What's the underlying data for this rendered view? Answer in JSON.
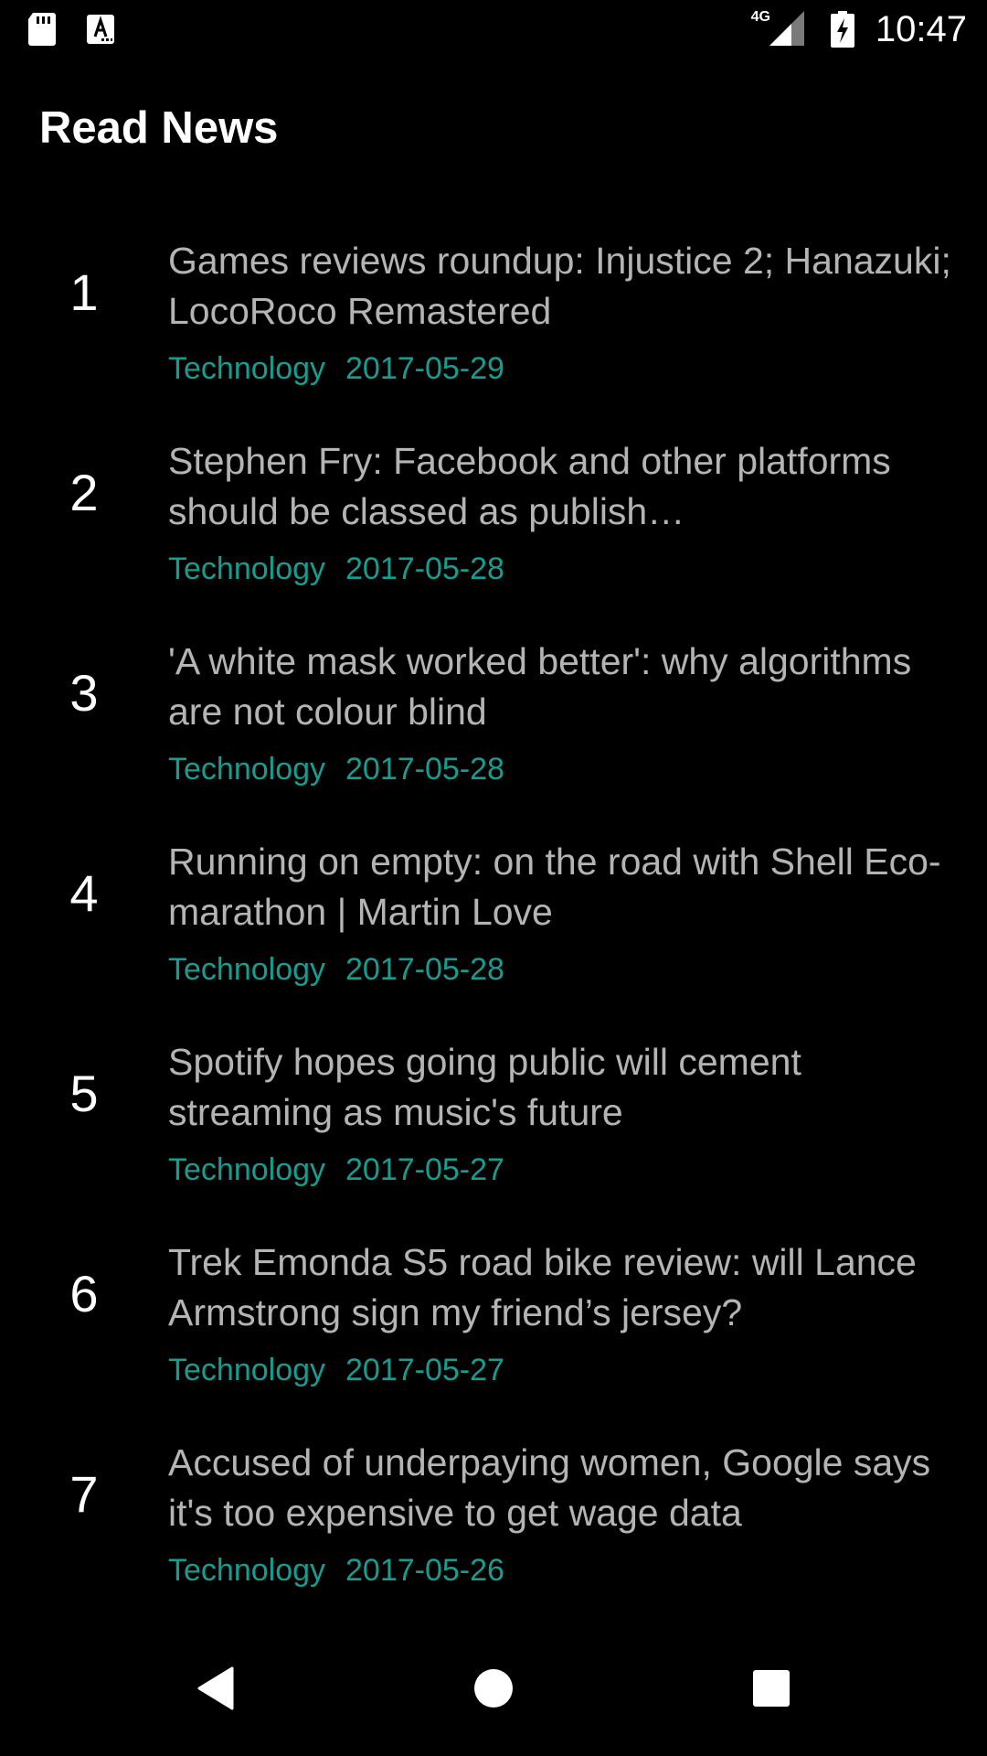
{
  "status_bar": {
    "time": "10:47",
    "network": "4G",
    "left_icons": [
      "sd-card-icon",
      "font-download-icon"
    ],
    "right_icons": [
      "signal-icon",
      "battery-charging-icon"
    ]
  },
  "app_bar": {
    "title": "Read News"
  },
  "news": [
    {
      "index": "1",
      "title": "Games reviews roundup: Injustice 2; Hanazuki; LocoRoco Remastered",
      "category": "Technology",
      "date": "2017-05-29"
    },
    {
      "index": "2",
      "title": "Stephen Fry: Facebook and other platforms should be classed as publish…",
      "category": "Technology",
      "date": "2017-05-28"
    },
    {
      "index": "3",
      "title": "'A white mask worked better': why algorithms are not colour blind",
      "category": "Technology",
      "date": "2017-05-28"
    },
    {
      "index": "4",
      "title": "Running on empty: on the road with Shell Eco-marathon | Martin Love",
      "category": "Technology",
      "date": "2017-05-28"
    },
    {
      "index": "5",
      "title": "Spotify hopes going public will cement streaming as music's future",
      "category": "Technology",
      "date": "2017-05-27"
    },
    {
      "index": "6",
      "title": "Trek Emonda S5 road bike review: will Lance Armstrong sign my friend’s jersey?",
      "category": "Technology",
      "date": "2017-05-27"
    },
    {
      "index": "7",
      "title": "Accused of underpaying women, Google says it's too expensive to get wage data",
      "category": "Technology",
      "date": "2017-05-26"
    }
  ],
  "nav_bar": {
    "icons": [
      "back-icon",
      "home-icon",
      "recents-icon"
    ]
  },
  "colors": {
    "background": "#000000",
    "title_text": "#b4b4b4",
    "accent": "#169d8f",
    "primary_text": "#ffffff"
  }
}
